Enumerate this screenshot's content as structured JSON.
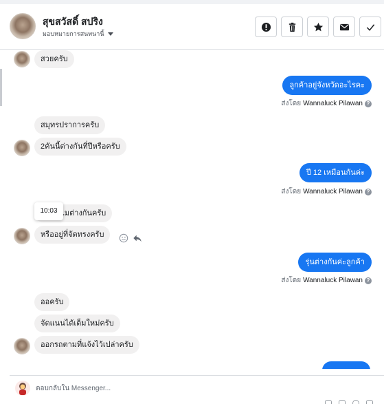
{
  "header": {
    "customer_name": "สุขสวัสดิ์ สปริง",
    "assign_label": "มอบหมายการสนทนานี้"
  },
  "actions": [
    {
      "name": "mark-important-button",
      "icon": "exclamation-circle-icon"
    },
    {
      "name": "delete-button",
      "icon": "trash-icon"
    },
    {
      "name": "star-button",
      "icon": "star-icon"
    },
    {
      "name": "mark-unread-button",
      "icon": "envelope-icon"
    },
    {
      "name": "mark-done-button",
      "icon": "check-icon"
    }
  ],
  "messages": {
    "m1": "สวยครับ",
    "m2": "ลูกค้าอยู่จังหวัดอะไรคะ",
    "m3": "สมุทรปราการครับ",
    "m4": "2คันนี้ต่างกันที่ปีหรือครับ",
    "m5": "ปี 12 เหมือนกันค่ะ",
    "m6": "ถาไมต่างกันครับ",
    "m7": "หรืออยู่ที่จัดทรงครับ",
    "m8": "รุ่นต่างกันค่ะลูกค้า",
    "m9": "ออครับ",
    "m10": "จัดแนนได้เต็มใหม่ครับ",
    "m11": "ออกรถตามที่แจ้งไว้เปล่าครับ"
  },
  "sent_by": {
    "prefix": "ส่งโดย",
    "agent": "Wannaluck Pilawan",
    "help": "?"
  },
  "tooltip_time": "10:03",
  "composer": {
    "placeholder": "ตอบกลับใน Messenger..."
  },
  "colors": {
    "outgoing_bubble": "#1877f2",
    "incoming_bubble": "#f1f0f0"
  }
}
